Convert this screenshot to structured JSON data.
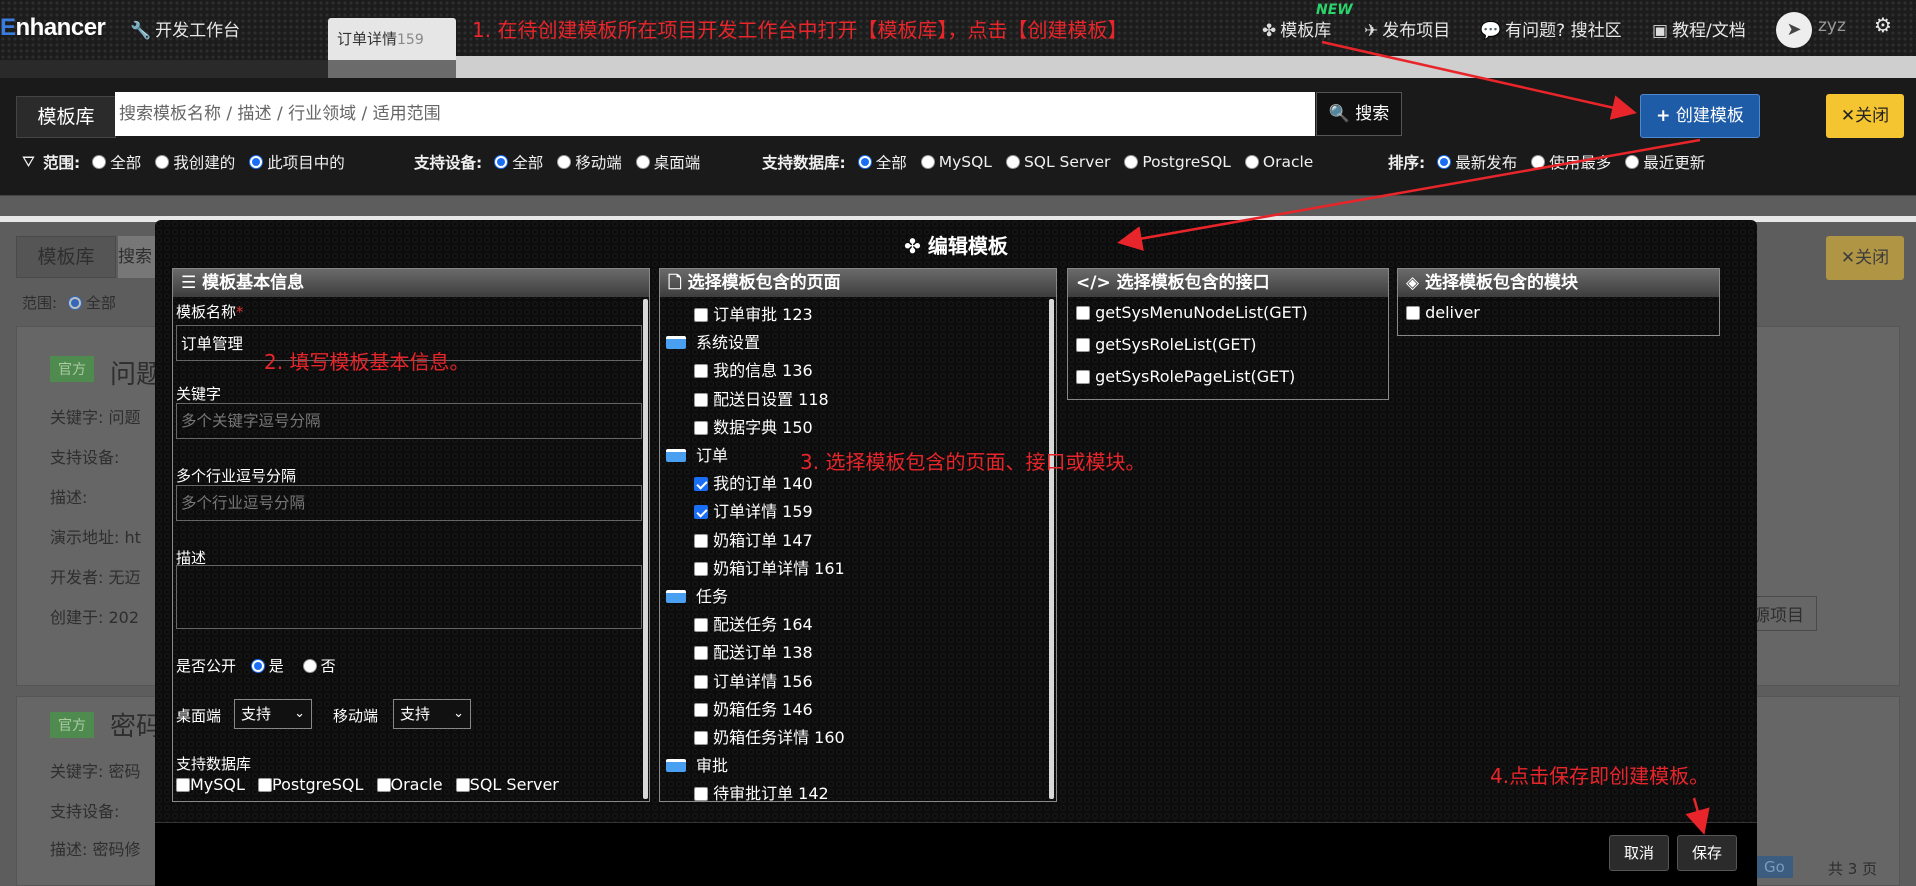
{
  "topnav": {
    "logo_prefix": "E",
    "logo_rest": "nhancer",
    "workbench": "开发工作台",
    "tab_label": "订单详情",
    "tab_num": "159",
    "template_lib": "模板库",
    "new_badge": "NEW",
    "publish": "发布项目",
    "question": "有问题? 搜社区",
    "docs": "教程/文档",
    "user": "zyz"
  },
  "search": {
    "label": "模板库",
    "placeholder": "搜索模板名称 / 描述 / 行业领域 / 适用范围",
    "search_btn": "搜索",
    "create_btn": "创建模板",
    "close_btn": "关闭"
  },
  "filters": {
    "scope_label": "范围:",
    "scope_opts": [
      "全部",
      "我创建的",
      "此项目中的"
    ],
    "device_label": "支持设备:",
    "device_opts": [
      "全部",
      "移动端",
      "桌面端"
    ],
    "db_label": "支持数据库:",
    "db_opts": [
      "全部",
      "MySQL",
      "SQL Server",
      "PostgreSQL",
      "Oracle"
    ],
    "sort_label": "排序:",
    "sort_opts": [
      "最新发布",
      "使用最多",
      "最近更新"
    ]
  },
  "background": {
    "lib": "模板库",
    "search": "搜索",
    "scope": "范围:",
    "all": "全部",
    "badge": "官方",
    "card1_title": "问题",
    "card2_title": "密码",
    "keyword": "关键字:",
    "kw1": "问题",
    "kw2": "密码",
    "devices": "支持设备:",
    "desc": "描述:",
    "desc2_val": "密码修",
    "demo": "演示地址:",
    "demo_val": "ht",
    "developer": "开发者:",
    "dev_val": "无迈",
    "created": "创建于:",
    "created_val": "202",
    "project_btn": "源项目",
    "go": "Go",
    "pages_total": "共 3 页",
    "close_btn": "关闭"
  },
  "modal": {
    "title": "编辑模板",
    "basic": {
      "header": "模板基本信息",
      "name_label": "模板名称",
      "name_value": "订单管理",
      "keyword_label": "关键字",
      "keyword_placeholder": "多个关键字逗号分隔",
      "industry_label": "多个行业逗号分隔",
      "industry_placeholder": "多个行业逗号分隔",
      "desc_label": "描述",
      "public_label": "是否公开",
      "public_yes": "是",
      "public_no": "否",
      "desktop_label": "桌面端",
      "desktop_value": "支持",
      "mobile_label": "移动端",
      "mobile_value": "支持",
      "db_label": "支持数据库",
      "db_opts": [
        "MySQL",
        "PostgreSQL",
        "Oracle",
        "SQL Server"
      ]
    },
    "pages": {
      "header": "选择模板包含的页面",
      "rows": [
        {
          "type": "page",
          "label": "订单审批 123",
          "checked": false
        },
        {
          "type": "folder",
          "label": "系统设置"
        },
        {
          "type": "page",
          "label": "我的信息 136",
          "checked": false
        },
        {
          "type": "page",
          "label": "配送日设置 118",
          "checked": false
        },
        {
          "type": "page",
          "label": "数据字典 150",
          "checked": false
        },
        {
          "type": "folder",
          "label": "订单"
        },
        {
          "type": "page",
          "label": "我的订单 140",
          "checked": true
        },
        {
          "type": "page",
          "label": "订单详情 159",
          "checked": true
        },
        {
          "type": "page",
          "label": "奶箱订单 147",
          "checked": false
        },
        {
          "type": "page",
          "label": "奶箱订单详情 161",
          "checked": false
        },
        {
          "type": "folder",
          "label": "任务"
        },
        {
          "type": "page",
          "label": "配送任务 164",
          "checked": false
        },
        {
          "type": "page",
          "label": "配送订单 138",
          "checked": false
        },
        {
          "type": "page",
          "label": "订单详情 156",
          "checked": false
        },
        {
          "type": "page",
          "label": "奶箱任务 146",
          "checked": false
        },
        {
          "type": "page",
          "label": "奶箱任务详情 160",
          "checked": false
        },
        {
          "type": "folder",
          "label": "审批"
        },
        {
          "type": "page",
          "label": "待审批订单 142",
          "checked": false
        }
      ]
    },
    "apis": {
      "header": "选择模板包含的接口",
      "rows": [
        "getSysMenuNodeList(GET)",
        "getSysRoleList(GET)",
        "getSysRolePageList(GET)"
      ]
    },
    "modules": {
      "header": "选择模板包含的模块",
      "rows": [
        "deliver"
      ]
    },
    "cancel": "取消",
    "save": "保存"
  },
  "annotations": {
    "step1": "1. 在待创建模板所在项目开发工作台中打开【模板库】，点击【创建模板】",
    "step2": "2. 填写模板基本信息。",
    "step3": "3. 选择模板包含的页面、接口或模块。",
    "step4": "4.点击保存即创建模板。"
  },
  "colors": {
    "accent_blue": "#1f5ca8",
    "close_yellow": "#f4c431",
    "annotation_red": "#e8252a",
    "checkbox_blue": "#1a6ef5"
  }
}
